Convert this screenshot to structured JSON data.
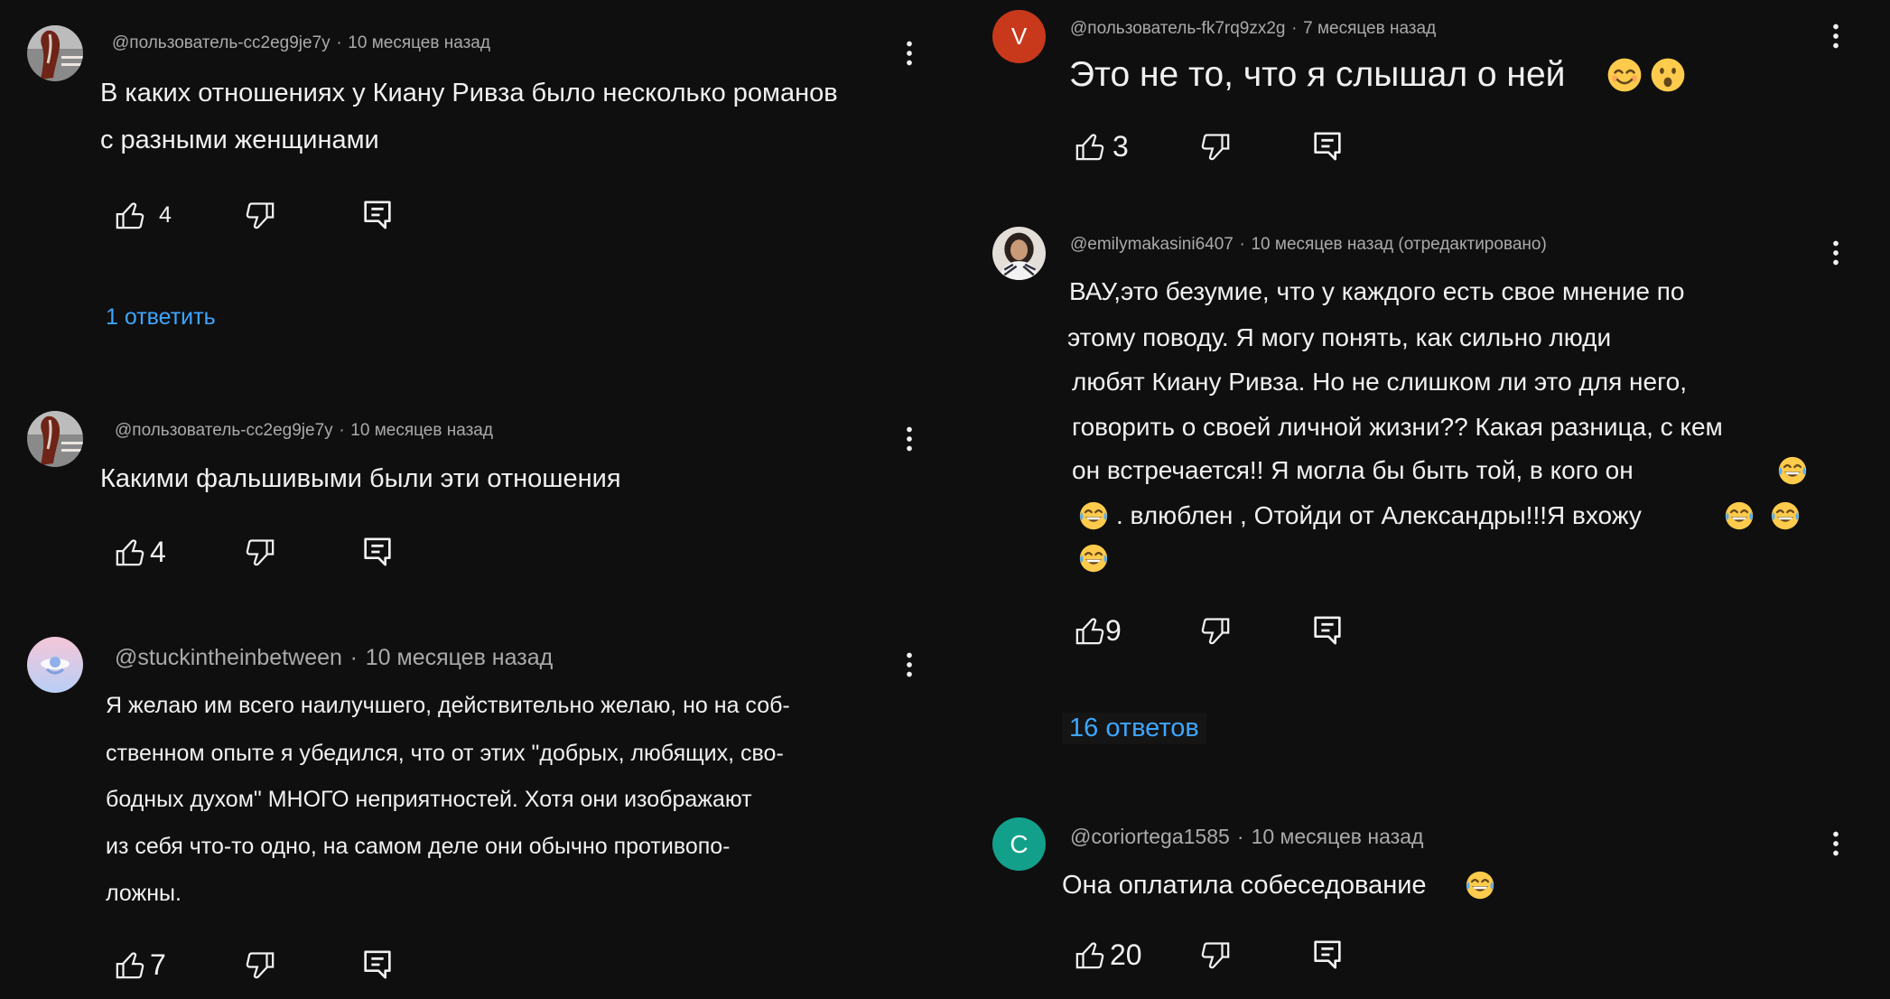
{
  "colors": {
    "background": "#0f0f0f",
    "text": "#f1f1f1",
    "meta": "#aaaaaa",
    "link": "#3ea6ff",
    "avatar_v": "#c8391b",
    "avatar_c": "#13a08b"
  },
  "icons": {
    "like": "thumbs-up-icon",
    "dislike": "thumbs-down-icon",
    "reply": "reply-icon",
    "more": "more-vertical-icon"
  },
  "separator": "·",
  "left": {
    "comments": [
      {
        "author": "@пользователь-cc2eg9je7y",
        "time": "10 месяцев назад",
        "avatar_icon": "horse-photo-avatar",
        "body_lines": [
          "В каких отношениях у Киану Ривза было несколько романов",
          "с разными женщинами"
        ],
        "likes": "4",
        "replies_label": "1 ответить"
      },
      {
        "author": "@пользователь-cc2eg9je7y",
        "time": "10 месяцев назад",
        "avatar_icon": "horse-photo-avatar",
        "body_lines": [
          "Какими фальшивыми были эти отношения"
        ],
        "likes": "4"
      },
      {
        "author": "@stuckintheinbetween",
        "time": "10 месяцев назад",
        "avatar_icon": "pastel-figure-avatar",
        "body_lines": [
          "Я желаю им всего наилучшего, действительно желаю, но на соб-",
          "ственном опыте я убедился, что от этих \"добрых, любящих, сво-",
          "бодных духом\" МНОГО неприятностей. Хотя они изображают",
          "из себя что-то одно, на самом деле они обычно противопо-",
          "ложны."
        ],
        "likes": "7"
      }
    ]
  },
  "right": {
    "comments": [
      {
        "author": "@пользователь-fk7rq9zx2g",
        "time": "7 месяцев назад",
        "avatar_letter": "V",
        "body_lines": [
          "Это не то, что я слышал о ней"
        ],
        "emoji": [
          "smiling-face-with-smiling-eyes",
          "face-with-open-mouth"
        ],
        "likes": "3"
      },
      {
        "author": "@emilymakasini6407",
        "time": "10 месяцев назад",
        "edited_label": "(отредактировано)",
        "avatar_icon": "woman-photo-avatar",
        "body_lines": [
          "ВАУ,это безумие, что у каждого есть свое мнение по",
          "этому поводу. Я могу понять, как сильно люди",
          "любят Киану Ривза. Но не слишком ли это для него,",
          "говорить о своей личной жизни?? Какая разница, с кем",
          "он встречается!! Я могла бы быть той, в кого он",
          ". влюблен , Отойди от Александры!!!Я вхожу"
        ],
        "emoji": [
          "face-with-tears-of-joy",
          "face-with-tears-of-joy",
          "face-with-tears-of-joy",
          "face-with-tears-of-joy",
          "face-with-tears-of-joy"
        ],
        "likes": "9",
        "replies_label": "16 ответов"
      },
      {
        "author": "@coriortega1585",
        "time": "10 месяцев назад",
        "avatar_letter": "C",
        "body_lines": [
          "Она оплатила собеседование"
        ],
        "emoji": [
          "face-with-tears-of-joy"
        ],
        "likes": "20"
      }
    ]
  }
}
